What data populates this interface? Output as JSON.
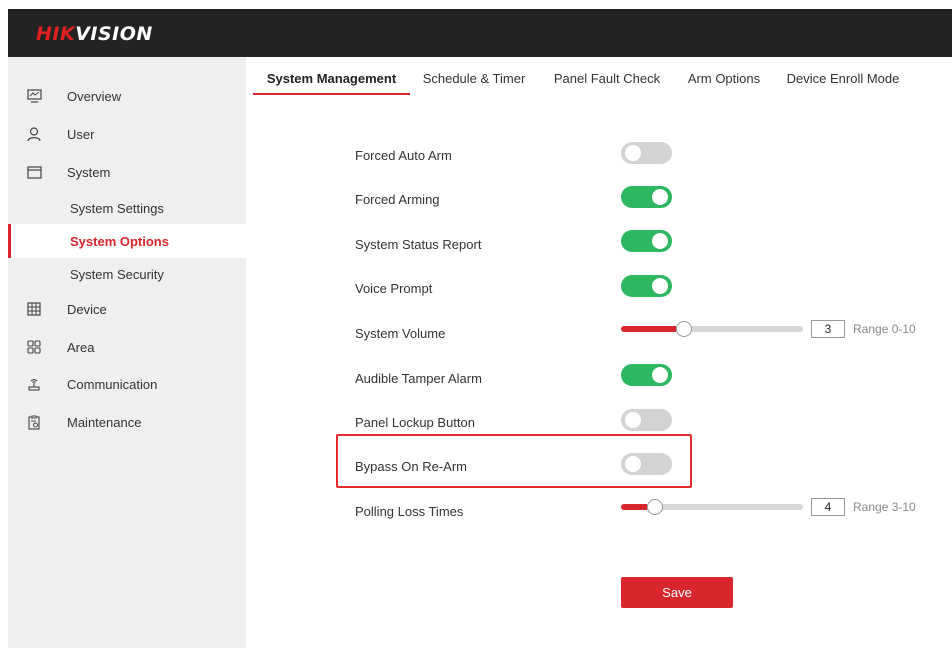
{
  "brand": {
    "logo_red": "HIK",
    "logo_white": "VISION"
  },
  "colors": {
    "accent": "#d9262c",
    "toggle_on": "#2db760",
    "toggle_off": "#d3d3d3",
    "highlight": "#e52a2a",
    "topbar": "#232323",
    "sidebar": "#efefef"
  },
  "sidebar": {
    "items": [
      {
        "label": "Overview",
        "icon": "monitor-icon"
      },
      {
        "label": "User",
        "icon": "user-icon"
      },
      {
        "label": "System",
        "icon": "window-icon"
      },
      {
        "label": "Device",
        "icon": "device-grid-icon"
      },
      {
        "label": "Area",
        "icon": "area-grid-icon"
      },
      {
        "label": "Communication",
        "icon": "antenna-icon"
      },
      {
        "label": "Maintenance",
        "icon": "clipboard-gear-icon"
      }
    ],
    "system_sub": [
      {
        "label": "System Settings",
        "active": false
      },
      {
        "label": "System Options",
        "active": true
      },
      {
        "label": "System Security",
        "active": false
      }
    ]
  },
  "tabs": [
    {
      "label": "System Management",
      "active": true
    },
    {
      "label": "Schedule & Timer",
      "active": false
    },
    {
      "label": "Panel Fault Check",
      "active": false
    },
    {
      "label": "Arm Options",
      "active": false
    },
    {
      "label": "Device Enroll Mode",
      "active": false
    }
  ],
  "settings": {
    "forced_auto_arm": {
      "label": "Forced Auto Arm",
      "on": false
    },
    "forced_arming": {
      "label": "Forced Arming",
      "on": true
    },
    "system_status_report": {
      "label": "System Status Report",
      "on": true
    },
    "voice_prompt": {
      "label": "Voice Prompt",
      "on": true
    },
    "system_volume": {
      "label": "System Volume",
      "value": "3",
      "min": 0,
      "max": 10,
      "range_text": "Range 0-10"
    },
    "audible_tamper_alarm": {
      "label": "Audible Tamper Alarm",
      "on": true
    },
    "panel_lockup_button": {
      "label": "Panel Lockup Button",
      "on": false
    },
    "bypass_on_rearm": {
      "label": "Bypass On Re-Arm",
      "on": false
    },
    "polling_loss_times": {
      "label": "Polling Loss Times",
      "value": "4",
      "min": 3,
      "max": 10,
      "range_text": "Range 3-10"
    }
  },
  "save_label": "Save"
}
